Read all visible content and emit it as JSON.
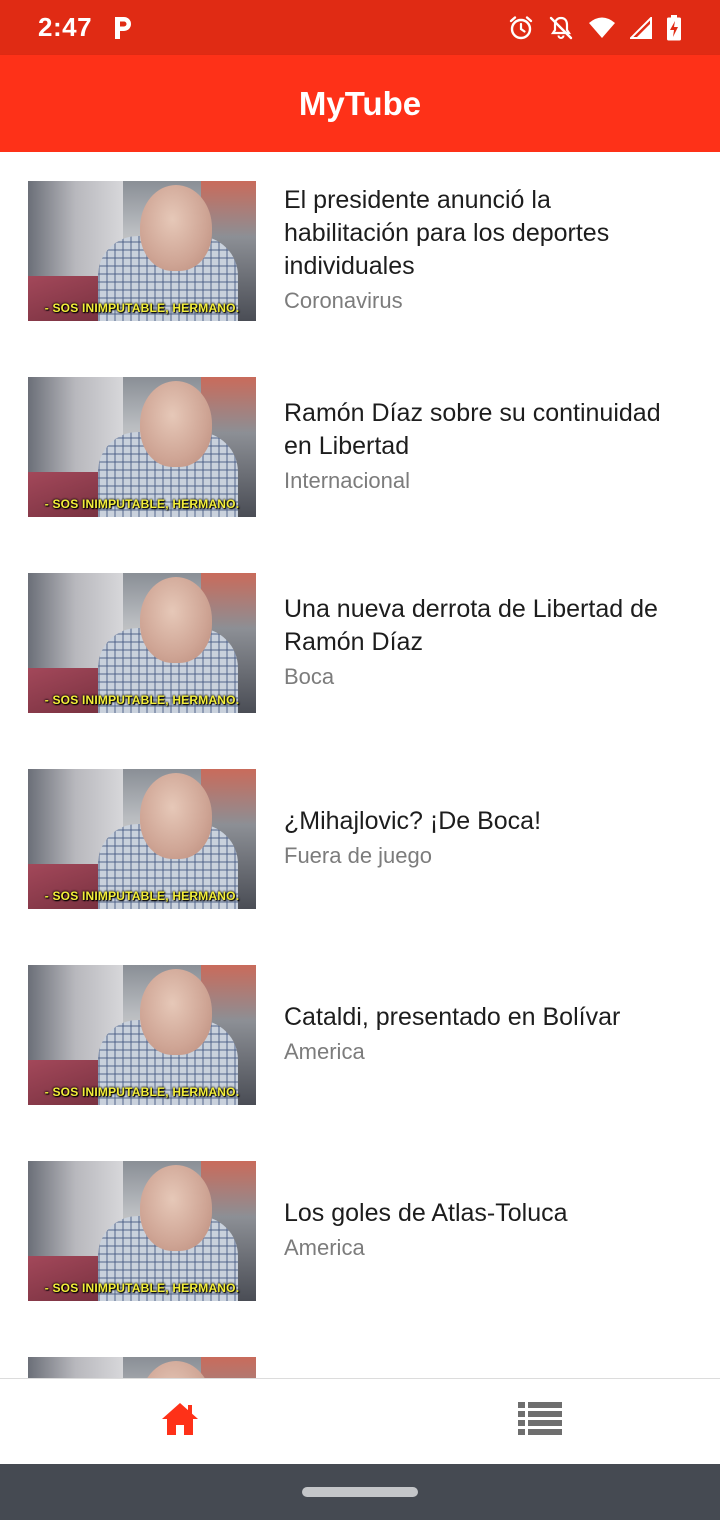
{
  "status_bar": {
    "time": "2:47",
    "icons": [
      "parking-p-icon",
      "alarm-icon",
      "notifications-off-icon",
      "wifi-icon",
      "signal-icon",
      "battery-charging-icon"
    ]
  },
  "app_bar": {
    "title": "MyTube"
  },
  "colors": {
    "status_bar": "#e02b14",
    "app_bar": "#fe3118",
    "accent": "#fe3118",
    "nav_inactive": "#6e6e6e"
  },
  "thumbnail": {
    "caption": "- SOS INIMPUTABLE, HERMANO."
  },
  "videos": [
    {
      "title": "El presidente anunció la habilitación para los deportes individuales",
      "category": "Coronavirus"
    },
    {
      "title": "Ramón Díaz sobre su continuidad en Libertad",
      "category": "Internacional"
    },
    {
      "title": "Una nueva derrota de Libertad de Ramón Díaz",
      "category": "Boca"
    },
    {
      "title": "¿Mihajlovic? ¡De Boca!",
      "category": "Fuera de juego"
    },
    {
      "title": "Cataldi, presentado en Bolívar",
      "category": "America"
    },
    {
      "title": "Los goles de Atlas-Toluca",
      "category": "America"
    }
  ],
  "bottom_nav": {
    "items": [
      {
        "icon": "home-icon",
        "active": true
      },
      {
        "icon": "list-icon",
        "active": false
      }
    ]
  }
}
